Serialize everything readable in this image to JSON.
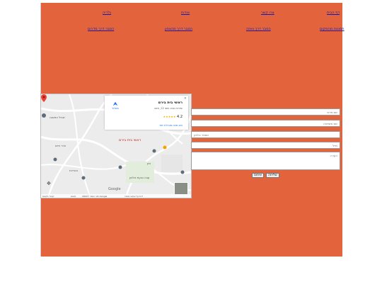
{
  "nav": {
    "row1": [
      "דף הבית",
      "צרו קשר",
      "אודות",
      "גלריה"
    ],
    "row2": [
      "תמונות מהמקום",
      "הסבר דרך וואזה",
      "הסבר דרך מהצפון",
      "הסבר דרך מדרום"
    ]
  },
  "map": {
    "card": {
      "directions_label": "מסלול",
      "title": "ראשי בית בירם",
      "address": "שדרות אבא חושי 22, חיפה",
      "rating": "4.2",
      "stars": "★★★★★",
      "more_link": "הצג מפה מוגדלת יותר"
    },
    "pin_label": "ראשי בית בירם",
    "street_labels": [
      "שביל הפסגה",
      "הדר חיים",
      "חזן",
      "הנוריות",
      "עבה גבעת טלבון"
    ],
    "google": "Google",
    "footer": [
      "קיצורי מקשים",
      "נתוני המפה ©2024 Google",
      "תנאים",
      "דיווח על שגיאה במפה"
    ]
  },
  "form": {
    "name_placeholder": "שם פרטי",
    "lastname_placeholder": "שם משפחה",
    "phone_placeholder": "מספר טלפון",
    "email_placeholder": "מייל",
    "message_placeholder": "הערה",
    "send_label": "שליחה",
    "reset_label": "איפוס"
  },
  "colors": {
    "panel": "#e3643c",
    "link": "#1a1aa6",
    "pin": "#ea4335"
  }
}
